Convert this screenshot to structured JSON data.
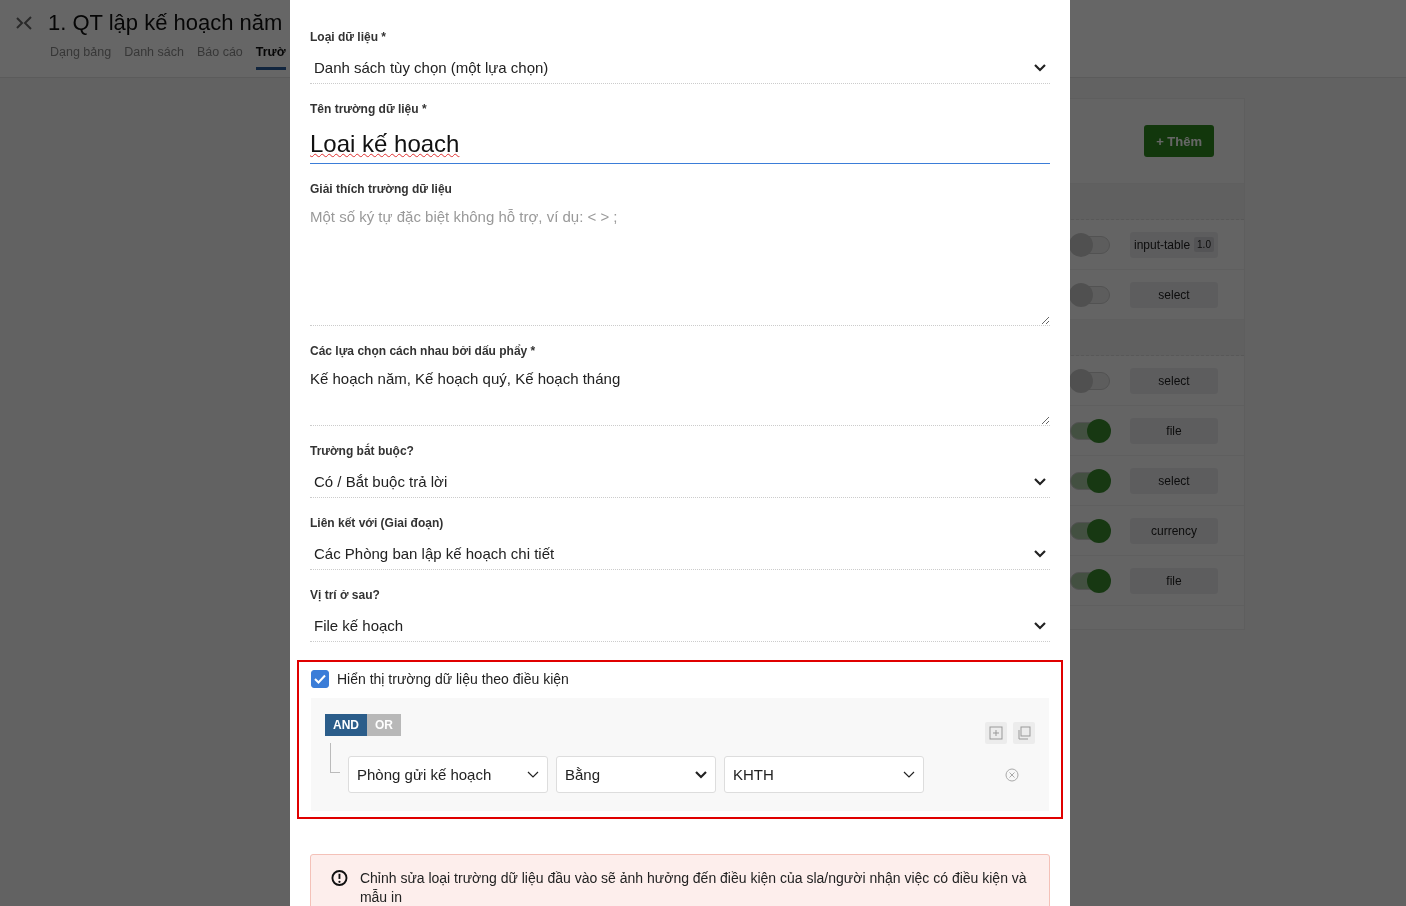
{
  "header": {
    "title": "1. QT lập kế hoạch năm",
    "tabs": [
      {
        "label": "Dạng bảng",
        "selected": false
      },
      {
        "label": "Danh sách",
        "selected": false
      },
      {
        "label": "Báo cáo",
        "selected": false
      },
      {
        "label": "Trườ",
        "selected": true
      }
    ]
  },
  "field_list": {
    "add_button": "+ Thêm",
    "groups": [
      {
        "fields": [
          {
            "type": "input-table",
            "version": "1.0",
            "on": false
          },
          {
            "type": "select",
            "on": false
          }
        ]
      },
      {
        "fields": [
          {
            "type": "select",
            "on": false
          },
          {
            "type": "file",
            "on": true
          },
          {
            "type": "select",
            "on": true
          },
          {
            "type": "currency",
            "on": true
          },
          {
            "type": "file",
            "on": true
          }
        ]
      }
    ]
  },
  "dialog": {
    "fields": [
      {
        "kind": "select",
        "label": "Loại dữ liệu *",
        "value": "Danh sách tùy chọn (một lựa chọn)"
      },
      {
        "kind": "text",
        "label": "Tên trường dữ liệu *",
        "value": "Loai kế hoach",
        "focused": true
      },
      {
        "kind": "textarea",
        "label": "Giải thích trường dữ liệu",
        "placeholder": "Một số ký tự đặc biệt không hỗ trợ, ví dụ: < > ;",
        "tall": true
      },
      {
        "kind": "textarea",
        "label": "Các lựa chọn cách nhau bởi dấu phẩy *",
        "value": "Kế hoạch năm, Kế hoạch quý, Kế hoạch tháng",
        "tall": false
      },
      {
        "kind": "select",
        "label": "Trường bắt buộc?",
        "value": "Có / Bắt buộc trả lời"
      },
      {
        "kind": "select",
        "label": "Liên kết với (Giai đoạn)",
        "value": "Các Phòng ban lập kế hoạch chi tiết"
      },
      {
        "kind": "select",
        "label": "Vị trí ở sau?",
        "value": "File kế hoạch"
      }
    ],
    "condition": {
      "highlighted": true,
      "checked": true,
      "label": "Hiển thị trường dữ liệu theo điều kiện",
      "operators": [
        {
          "label": "AND",
          "selected": true
        },
        {
          "label": "OR",
          "selected": false
        }
      ],
      "rule": {
        "field": "Phòng gửi kế hoạch",
        "operator": "Bằng",
        "value": "KHTH"
      }
    },
    "warning": "Chỉnh sửa loại trường dữ liệu đầu vào sẽ ảnh hưởng đến điều kiện của sla/người nhận việc có điều kiện và mẫu in"
  }
}
